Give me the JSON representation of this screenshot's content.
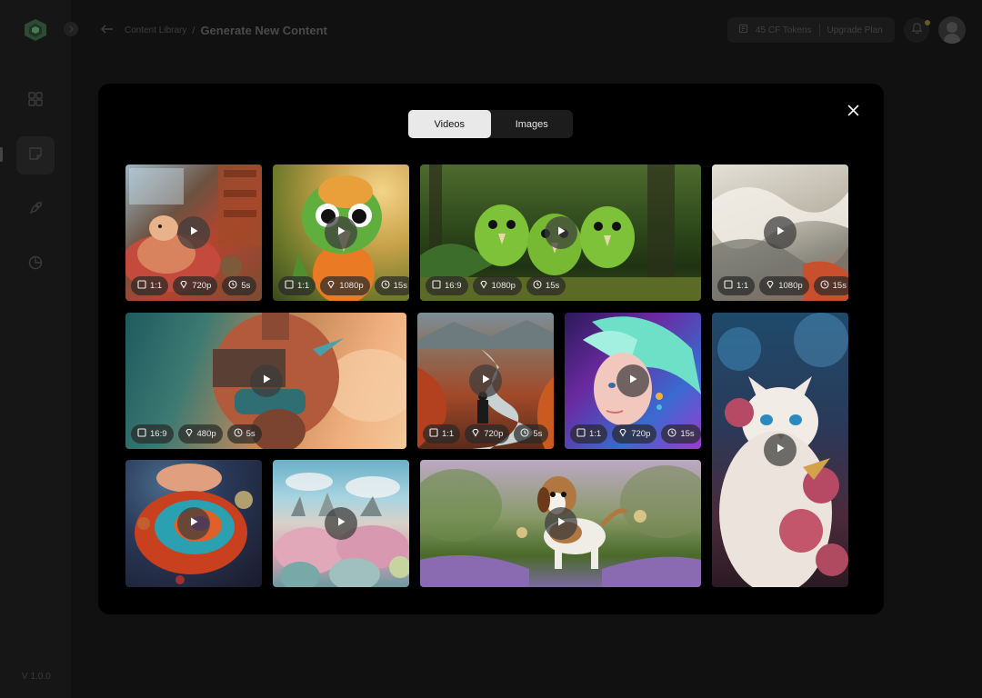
{
  "app": {
    "version": "V 1.0.0"
  },
  "breadcrumb": {
    "parent": "Content Library",
    "separator": "/",
    "current": "Generate New Content"
  },
  "tokens": {
    "label": "45 CF Tokens",
    "upgrade": "Upgrade Plan"
  },
  "modal": {
    "tabs": [
      {
        "label": "Videos",
        "active": true
      },
      {
        "label": "Images",
        "active": false
      }
    ]
  },
  "tiles": [
    {
      "name": "cozy-hamster",
      "ratio": "1:1",
      "res": "720p",
      "dur": "5s"
    },
    {
      "name": "parrot",
      "ratio": "1:1",
      "res": "1080p",
      "dur": "15s"
    },
    {
      "name": "green-birds",
      "ratio": "16:9",
      "res": "1080p",
      "dur": "15s"
    },
    {
      "name": "smoke-abstract",
      "ratio": "1:1",
      "res": "1080p",
      "dur": "15s"
    },
    {
      "name": "vr-surreal",
      "ratio": "16:9",
      "res": "480p",
      "dur": "5s"
    },
    {
      "name": "river-valley",
      "ratio": "1:1",
      "res": "720p",
      "dur": "5s"
    },
    {
      "name": "neon-girl",
      "ratio": "1:1",
      "res": "720p",
      "dur": "15s"
    },
    {
      "name": "white-cat",
      "ratio": "",
      "res": "",
      "dur": ""
    },
    {
      "name": "planet-swirl",
      "ratio": "",
      "res": "",
      "dur": ""
    },
    {
      "name": "coral-landscape",
      "ratio": "",
      "res": "",
      "dur": ""
    },
    {
      "name": "beagle",
      "ratio": "",
      "res": "",
      "dur": ""
    }
  ]
}
